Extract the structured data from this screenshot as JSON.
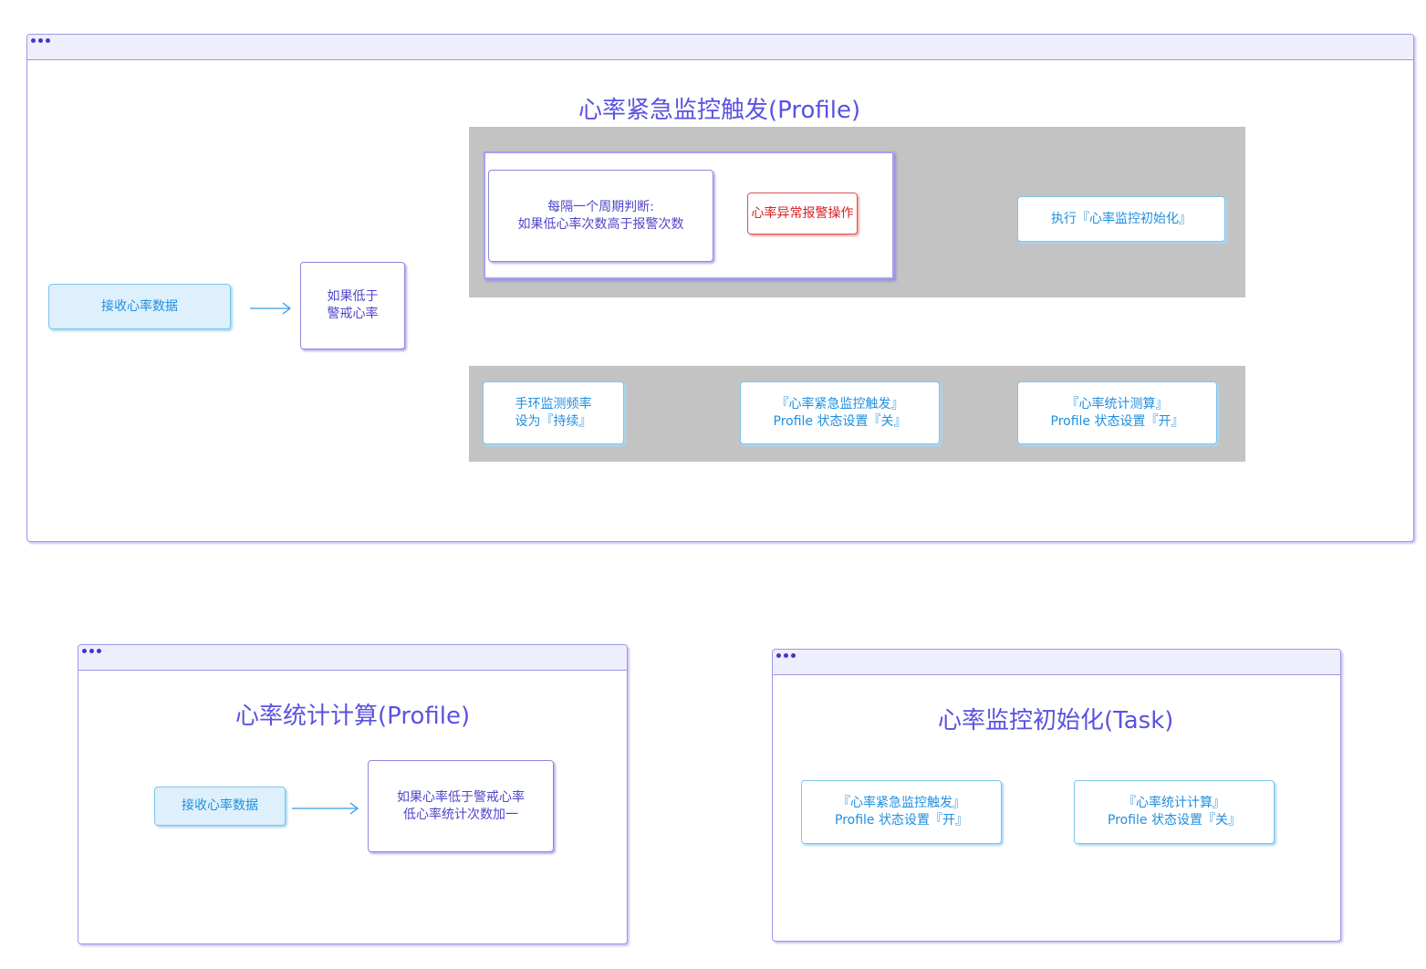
{
  "colors": {
    "window_border": "#9c96ea",
    "titlebar_bg": "#efeefc",
    "title_text": "#5b52e0",
    "panel_bg": "#c3c3c3",
    "blue_text": "#1f8fe0",
    "purple_text": "#5046c8",
    "red_text": "#d62020",
    "arrow": "#3a9be0"
  },
  "emergency": {
    "title": "心率紧急监控触发(Profile)",
    "receive": "接收心率数据",
    "condition": [
      "如果低于",
      "警戒心率"
    ],
    "periodic_check": [
      "每隔一个周期判断:",
      "如果低心率次数高于报警次数"
    ],
    "alarm_action": "心率异常报警操作",
    "run_init": "执行『心率监控初始化』",
    "set_freq": [
      "手环监测频率",
      "设为『持续』"
    ],
    "set_emergency_off": [
      "『心率紧急监控触发』",
      "Profile 状态设置『关』"
    ],
    "set_stats_on": [
      "『心率统计测算』",
      "Profile 状态设置『开』"
    ]
  },
  "stats": {
    "title": "心率统计计算(Profile)",
    "receive": "接收心率数据",
    "condition": [
      "如果心率低于警戒心率",
      "低心率统计次数加一"
    ]
  },
  "init": {
    "title": "心率监控初始化(Task)",
    "set_emergency_on": [
      "『心率紧急监控触发』",
      "Profile 状态设置『开』"
    ],
    "set_stats_off": [
      "『心率统计计算』",
      "Profile 状态设置『关』"
    ]
  }
}
